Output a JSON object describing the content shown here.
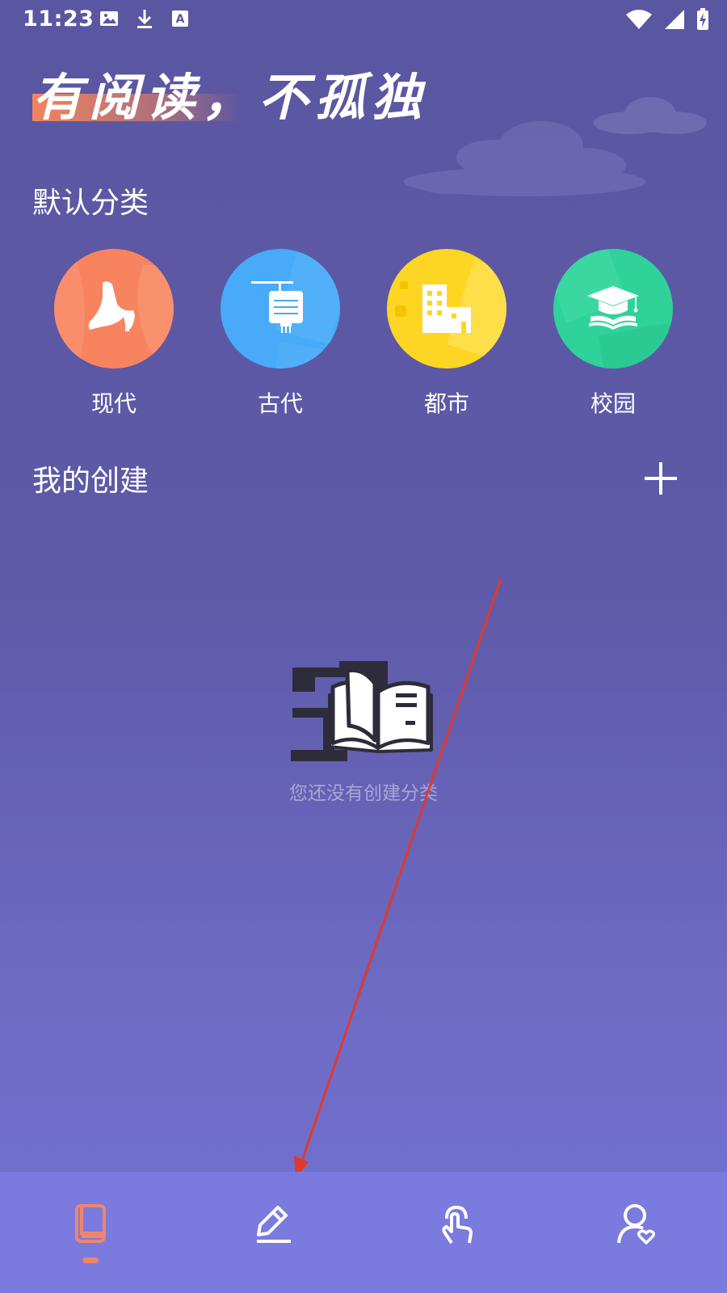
{
  "status_bar": {
    "time": "11:23",
    "left_icons": [
      "image-icon",
      "download-icon",
      "text-a-icon"
    ],
    "right_icons": [
      "wifi-icon",
      "signal-icon",
      "battery-charging-icon"
    ]
  },
  "header": {
    "slogan": "有阅读，不孤独"
  },
  "default_categories": {
    "title": "默认分类",
    "items": [
      {
        "label": "现代",
        "icon": "high-heel-icon",
        "color": "#f8845f"
      },
      {
        "label": "古代",
        "icon": "scroll-lantern-icon",
        "color": "#48aaf8"
      },
      {
        "label": "都市",
        "icon": "city-buildings-icon",
        "color": "#fdd623"
      },
      {
        "label": "校园",
        "icon": "graduation-cap-book-icon",
        "color": "#2fd39a"
      }
    ]
  },
  "my_creations": {
    "title": "我的创建",
    "add_icon": "plus-icon",
    "empty_icon": "open-book-icon",
    "empty_message": "您还没有创建分类"
  },
  "bottom_nav": {
    "items": [
      {
        "icon": "bookshelf-icon",
        "active": true,
        "color": "#f0856a"
      },
      {
        "icon": "pencil-write-icon",
        "active": false,
        "color": "#ffffff"
      },
      {
        "icon": "touch-hand-icon",
        "active": false,
        "color": "#ffffff"
      },
      {
        "icon": "user-heart-icon",
        "active": false,
        "color": "#ffffff"
      }
    ]
  }
}
